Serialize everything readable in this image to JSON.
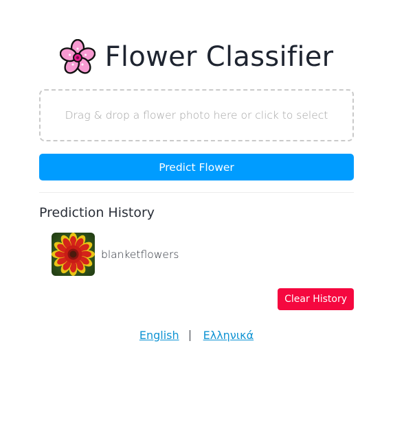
{
  "header": {
    "title": "Flower Classifier",
    "icon": "cherry-blossom-icon"
  },
  "upload": {
    "dropzone_text": "Drag & drop a flower photo here or click to select"
  },
  "actions": {
    "predict_label": "Predict Flower",
    "clear_label": "Clear History"
  },
  "history": {
    "heading": "Prediction History",
    "items": [
      {
        "label": "blanketflowers",
        "thumbnail": "blanketflower-photo"
      }
    ]
  },
  "languages": {
    "english": "English",
    "greek": "Ελληνικά"
  },
  "colors": {
    "primary": "#009cff",
    "danger": "#f5083f",
    "link": "#0f93d3"
  }
}
